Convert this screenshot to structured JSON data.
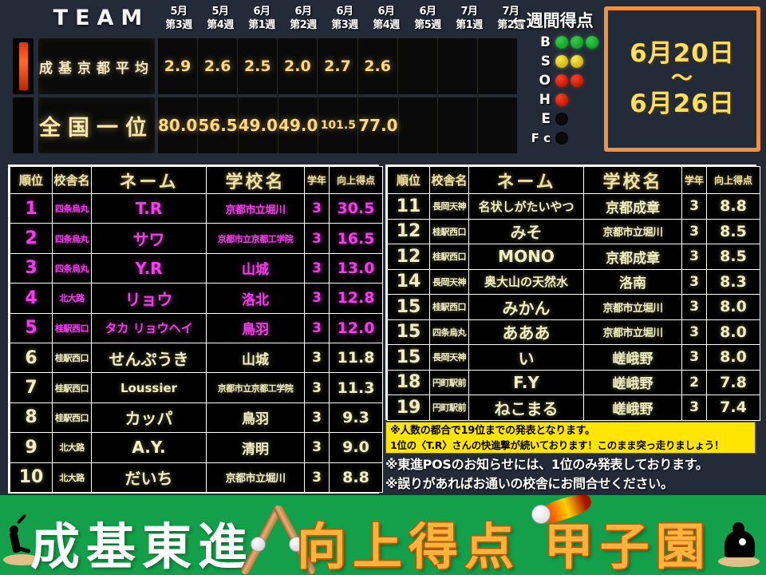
{
  "scoreboard": {
    "team_word": "TEAM",
    "weekly_label": "←週間得点",
    "week_headers": [
      {
        "month": "5月",
        "week": "第3週"
      },
      {
        "month": "5月",
        "week": "第4週"
      },
      {
        "month": "6月",
        "week": "第1週"
      },
      {
        "month": "6月",
        "week": "第2週"
      },
      {
        "month": "6月",
        "week": "第3週"
      },
      {
        "month": "6月",
        "week": "第4週"
      },
      {
        "month": "6月",
        "week": "第5週"
      },
      {
        "month": "7月",
        "week": "第1週"
      },
      {
        "month": "7月",
        "week": "第2週"
      }
    ],
    "rows": [
      {
        "label": "成基京都平均",
        "values": [
          "2.9",
          "2.6",
          "2.5",
          "2.0",
          "2.7",
          "2.6",
          "",
          "",
          ""
        ]
      },
      {
        "label": "全国一位",
        "values": [
          "80.0",
          "56.5",
          "49.0",
          "49.0",
          "101.5",
          "77.0",
          "",
          "",
          ""
        ]
      }
    ],
    "bso": [
      {
        "label": "B",
        "lit": 3,
        "total": 3,
        "color": "#2fbe41"
      },
      {
        "label": "S",
        "lit": 2,
        "total": 2,
        "color": "#e3cc1e"
      },
      {
        "label": "O",
        "lit": 2,
        "total": 2,
        "color": "#e03010"
      },
      {
        "label": "H",
        "lit": 1,
        "total": 1,
        "color": "#e03010"
      },
      {
        "label": "E",
        "lit": 0,
        "total": 1,
        "color": "#0b0b0b"
      },
      {
        "label": "F c",
        "lit": 0,
        "total": 1,
        "color": "#0b0b0b"
      }
    ],
    "date_box": {
      "start": "6月20日",
      "tilde": "〜",
      "end": "6月26日",
      "border_color": "#f0923f",
      "text_color": "#ffdf5c"
    }
  },
  "table_headers": {
    "rank": "順位",
    "branch": "校舎名",
    "name": "ネーム",
    "school": "学校名",
    "grade": "学年",
    "score": "向上得点"
  },
  "left_table": {
    "rows": [
      {
        "rank": "1",
        "branch": "四条烏丸",
        "name": "T.R",
        "school": "京都市立堀川",
        "grade": "3",
        "score": "30.5",
        "tone": "magenta"
      },
      {
        "rank": "2",
        "branch": "四条烏丸",
        "name": "サワ",
        "school": "京都市立京都工学院",
        "grade": "3",
        "score": "16.5",
        "tone": "magenta"
      },
      {
        "rank": "3",
        "branch": "四条烏丸",
        "name": "Y.R",
        "school": "山城",
        "grade": "3",
        "score": "13.0",
        "tone": "magenta"
      },
      {
        "rank": "4",
        "branch": "北大路",
        "name": "リョウ",
        "school": "洛北",
        "grade": "3",
        "score": "12.8",
        "tone": "magenta"
      },
      {
        "rank": "5",
        "branch": "桂駅西口",
        "name": "タカ リョウヘイ",
        "school": "鳥羽",
        "grade": "3",
        "score": "12.0",
        "tone": "magenta"
      },
      {
        "rank": "6",
        "branch": "桂駅西口",
        "name": "せんぷうき",
        "school": "山城",
        "grade": "3",
        "score": "11.8",
        "tone": "cream"
      },
      {
        "rank": "7",
        "branch": "桂駅西口",
        "name": "Loussier",
        "school": "京都市立京都工学院",
        "grade": "3",
        "score": "11.3",
        "tone": "cream"
      },
      {
        "rank": "8",
        "branch": "桂駅西口",
        "name": "カッパ",
        "school": "鳥羽",
        "grade": "3",
        "score": "9.3",
        "tone": "cream"
      },
      {
        "rank": "9",
        "branch": "北大路",
        "name": "A.Y.",
        "school": "清明",
        "grade": "3",
        "score": "9.0",
        "tone": "cream"
      },
      {
        "rank": "10",
        "branch": "北大路",
        "name": "だいち",
        "school": "京都市立堀川",
        "grade": "3",
        "score": "8.8",
        "tone": "cream"
      }
    ]
  },
  "right_table": {
    "rows": [
      {
        "rank": "11",
        "branch": "長岡天神",
        "name": "名状しがたいやつ",
        "school": "京都成章",
        "grade": "3",
        "score": "8.8",
        "tone": "cream"
      },
      {
        "rank": "12",
        "branch": "桂駅西口",
        "name": "みそ",
        "school": "京都市立堀川",
        "grade": "3",
        "score": "8.5",
        "tone": "cream"
      },
      {
        "rank": "12",
        "branch": "桂駅西口",
        "name": "MONO",
        "school": "京都成章",
        "grade": "3",
        "score": "8.5",
        "tone": "cream"
      },
      {
        "rank": "14",
        "branch": "長岡天神",
        "name": "奥大山の天然水",
        "school": "洛南",
        "grade": "3",
        "score": "8.3",
        "tone": "cream"
      },
      {
        "rank": "15",
        "branch": "桂駅西口",
        "name": "みかん",
        "school": "京都市立堀川",
        "grade": "3",
        "score": "8.0",
        "tone": "cream"
      },
      {
        "rank": "15",
        "branch": "四条烏丸",
        "name": "あああ",
        "school": "京都市立堀川",
        "grade": "3",
        "score": "8.0",
        "tone": "cream"
      },
      {
        "rank": "15",
        "branch": "長岡天神",
        "name": "い",
        "school": "嵯峨野",
        "grade": "3",
        "score": "8.0",
        "tone": "cream"
      },
      {
        "rank": "18",
        "branch": "円町駅前",
        "name": "F.Y",
        "school": "嵯峨野",
        "grade": "2",
        "score": "7.8",
        "tone": "cream"
      },
      {
        "rank": "19",
        "branch": "円町駅前",
        "name": "ねこまる",
        "school": "嵯峨野",
        "grade": "3",
        "score": "7.4",
        "tone": "cream"
      }
    ]
  },
  "notes": {
    "yellow_line1": "※人数の都合で19位までの発表となります。",
    "yellow_line2": "1位の〈T.R〉さんの快進撃が続いております！このまま突っ走りましょう！",
    "dark_line1": "※東進POSのお知らせには、1位のみ発表しております。",
    "dark_line2": "※誤りがあればお通いの校舎にお問合せください。",
    "yellow_bg": "#ffe500"
  },
  "banner": {
    "text_white": "成基東進",
    "text_orange": "向上得点 甲子園",
    "bg_color": "#14a04a",
    "orange_color": "#ffb23c"
  }
}
